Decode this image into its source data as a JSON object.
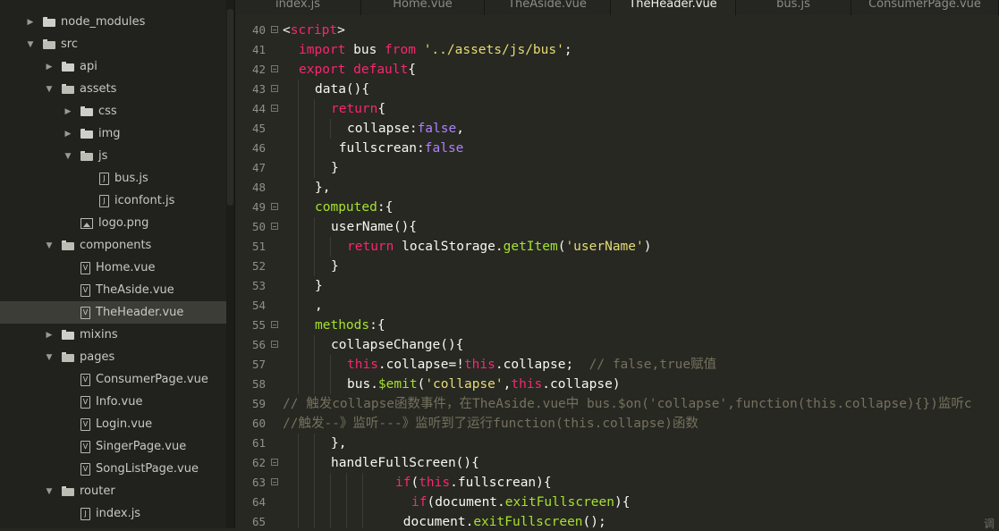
{
  "sidebar": {
    "items": [
      {
        "label": "node_modules",
        "kind": "folder",
        "depth": 0,
        "expanded": false,
        "active": false
      },
      {
        "label": "src",
        "kind": "folder",
        "depth": 0,
        "expanded": true,
        "active": false
      },
      {
        "label": "api",
        "kind": "folder",
        "depth": 1,
        "expanded": false,
        "active": false
      },
      {
        "label": "assets",
        "kind": "folder",
        "depth": 1,
        "expanded": true,
        "active": false
      },
      {
        "label": "css",
        "kind": "folder",
        "depth": 2,
        "expanded": false,
        "active": false
      },
      {
        "label": "img",
        "kind": "folder",
        "depth": 2,
        "expanded": false,
        "active": false
      },
      {
        "label": "js",
        "kind": "folder",
        "depth": 2,
        "expanded": true,
        "active": false
      },
      {
        "label": "bus.js",
        "kind": "js",
        "depth": 3,
        "active": false
      },
      {
        "label": "iconfont.js",
        "kind": "js",
        "depth": 3,
        "active": false
      },
      {
        "label": "logo.png",
        "kind": "image",
        "depth": 2,
        "active": false
      },
      {
        "label": "components",
        "kind": "folder",
        "depth": 1,
        "expanded": true,
        "active": false
      },
      {
        "label": "Home.vue",
        "kind": "vue",
        "depth": 2,
        "active": false
      },
      {
        "label": "TheAside.vue",
        "kind": "vue",
        "depth": 2,
        "active": false
      },
      {
        "label": "TheHeader.vue",
        "kind": "vue",
        "depth": 2,
        "active": true
      },
      {
        "label": "mixins",
        "kind": "folder",
        "depth": 1,
        "expanded": false,
        "active": false
      },
      {
        "label": "pages",
        "kind": "folder",
        "depth": 1,
        "expanded": true,
        "active": false
      },
      {
        "label": "ConsumerPage.vue",
        "kind": "vue",
        "depth": 2,
        "active": false
      },
      {
        "label": "Info.vue",
        "kind": "vue",
        "depth": 2,
        "active": false
      },
      {
        "label": "Login.vue",
        "kind": "vue",
        "depth": 2,
        "active": false
      },
      {
        "label": "SingerPage.vue",
        "kind": "vue",
        "depth": 2,
        "active": false
      },
      {
        "label": "SongListPage.vue",
        "kind": "vue",
        "depth": 2,
        "active": false
      },
      {
        "label": "router",
        "kind": "folder",
        "depth": 1,
        "expanded": true,
        "active": false
      },
      {
        "label": "index.js",
        "kind": "js",
        "depth": 2,
        "active": false
      }
    ]
  },
  "tabs": [
    {
      "label": "index.js",
      "active": false
    },
    {
      "label": "Home.vue",
      "active": false
    },
    {
      "label": "TheAside.vue",
      "active": false
    },
    {
      "label": "TheHeader.vue",
      "active": true
    },
    {
      "label": "bus.js",
      "active": false
    },
    {
      "label": "ConsumerPage.vue",
      "active": false
    }
  ],
  "editor": {
    "lines": [
      {
        "n": "40",
        "fold": true,
        "indent": 0,
        "tokens": [
          [
            "pl",
            "<"
          ],
          [
            "kw",
            "script"
          ],
          [
            "pl",
            ">"
          ]
        ]
      },
      {
        "n": "41",
        "fold": false,
        "indent": 1,
        "tokens": [
          [
            "kw",
            "import"
          ],
          [
            "pl",
            " bus "
          ],
          [
            "kw",
            "from"
          ],
          [
            "pl",
            " "
          ],
          [
            "str",
            "'../assets/js/bus'"
          ],
          [
            "pl",
            ";"
          ]
        ]
      },
      {
        "n": "42",
        "fold": true,
        "indent": 1,
        "tokens": [
          [
            "kw",
            "export"
          ],
          [
            "pl",
            " "
          ],
          [
            "kw",
            "default"
          ],
          [
            "pl",
            "{"
          ]
        ]
      },
      {
        "n": "43",
        "fold": true,
        "indent": 2,
        "tokens": [
          [
            "pl",
            "data(){"
          ]
        ]
      },
      {
        "n": "44",
        "fold": true,
        "indent": 3,
        "tokens": [
          [
            "kw",
            "return"
          ],
          [
            "pl",
            "{"
          ]
        ]
      },
      {
        "n": "45",
        "fold": false,
        "indent": 4,
        "tokens": [
          [
            "pl",
            "collapse:"
          ],
          [
            "cn",
            "false"
          ],
          [
            "pl",
            ","
          ]
        ]
      },
      {
        "n": "46",
        "fold": false,
        "indent": 3,
        "tokens": [
          [
            "pl",
            " fullscrean:"
          ],
          [
            "cn",
            "false"
          ]
        ]
      },
      {
        "n": "47",
        "fold": false,
        "indent": 3,
        "tokens": [
          [
            "pl",
            "}"
          ]
        ]
      },
      {
        "n": "48",
        "fold": false,
        "indent": 2,
        "tokens": [
          [
            "pl",
            "},"
          ]
        ]
      },
      {
        "n": "49",
        "fold": true,
        "indent": 2,
        "tokens": [
          [
            "fn",
            "computed"
          ],
          [
            "pl",
            ":{"
          ]
        ]
      },
      {
        "n": "50",
        "fold": true,
        "indent": 3,
        "tokens": [
          [
            "pl",
            "userName(){"
          ]
        ]
      },
      {
        "n": "51",
        "fold": false,
        "indent": 4,
        "tokens": [
          [
            "kw",
            "return"
          ],
          [
            "pl",
            " localStorage."
          ],
          [
            "fn",
            "getItem"
          ],
          [
            "pl",
            "("
          ],
          [
            "str",
            "'userName'"
          ],
          [
            "pl",
            ")"
          ]
        ]
      },
      {
        "n": "52",
        "fold": false,
        "indent": 3,
        "tokens": [
          [
            "pl",
            "}"
          ]
        ]
      },
      {
        "n": "53",
        "fold": false,
        "indent": 2,
        "tokens": [
          [
            "pl",
            "}"
          ]
        ]
      },
      {
        "n": "54",
        "fold": false,
        "indent": 2,
        "tokens": [
          [
            "pl",
            ","
          ]
        ]
      },
      {
        "n": "55",
        "fold": true,
        "indent": 2,
        "tokens": [
          [
            "fn",
            "methods"
          ],
          [
            "pl",
            ":{"
          ]
        ]
      },
      {
        "n": "56",
        "fold": true,
        "indent": 3,
        "tokens": [
          [
            "pl",
            "collapseChange(){"
          ]
        ]
      },
      {
        "n": "57",
        "fold": false,
        "indent": 4,
        "tokens": [
          [
            "kw",
            "this"
          ],
          [
            "pl",
            ".collapse=!"
          ],
          [
            "kw",
            "this"
          ],
          [
            "pl",
            ".collapse;  "
          ],
          [
            "cm",
            "// false,true赋值"
          ]
        ]
      },
      {
        "n": "58",
        "fold": false,
        "indent": 4,
        "tokens": [
          [
            "pl",
            "bus."
          ],
          [
            "fn",
            "$emit"
          ],
          [
            "pl",
            "("
          ],
          [
            "str",
            "'collapse'"
          ],
          [
            "pl",
            ","
          ],
          [
            "kw",
            "this"
          ],
          [
            "pl",
            ".collapse)"
          ]
        ]
      },
      {
        "n": "59",
        "fold": false,
        "indent": 0,
        "tokens": [
          [
            "cm",
            "// 触发collapse函数事件，在TheAside.vue中 bus.$on('collapse',function(this.collapse){})监听c"
          ]
        ]
      },
      {
        "n": "60",
        "fold": false,
        "indent": 0,
        "tokens": [
          [
            "cm",
            "//触发--》监听---》监听到了运行function(this.collapse)函数"
          ]
        ]
      },
      {
        "n": "61",
        "fold": false,
        "indent": 3,
        "tokens": [
          [
            "pl",
            "},"
          ]
        ]
      },
      {
        "n": "62",
        "fold": true,
        "indent": 3,
        "tokens": [
          [
            "pl",
            "handleFullScreen(){"
          ]
        ]
      },
      {
        "n": "63",
        "fold": true,
        "indent": 7,
        "tokens": [
          [
            "kw",
            "if"
          ],
          [
            "pl",
            "("
          ],
          [
            "kw",
            "this"
          ],
          [
            "pl",
            ".fullscrean){"
          ]
        ]
      },
      {
        "n": "64",
        "fold": false,
        "indent": 8,
        "tokens": [
          [
            "kw",
            "if"
          ],
          [
            "pl",
            "(document."
          ],
          [
            "fn",
            "exitFullscreen"
          ],
          [
            "pl",
            "){"
          ]
        ]
      },
      {
        "n": "65",
        "fold": false,
        "indent": 7,
        "tokens": [
          [
            "pl",
            " document."
          ],
          [
            "fn",
            "exitFullscreen"
          ],
          [
            "pl",
            "();"
          ]
        ]
      }
    ]
  },
  "corner_glyph": "调"
}
